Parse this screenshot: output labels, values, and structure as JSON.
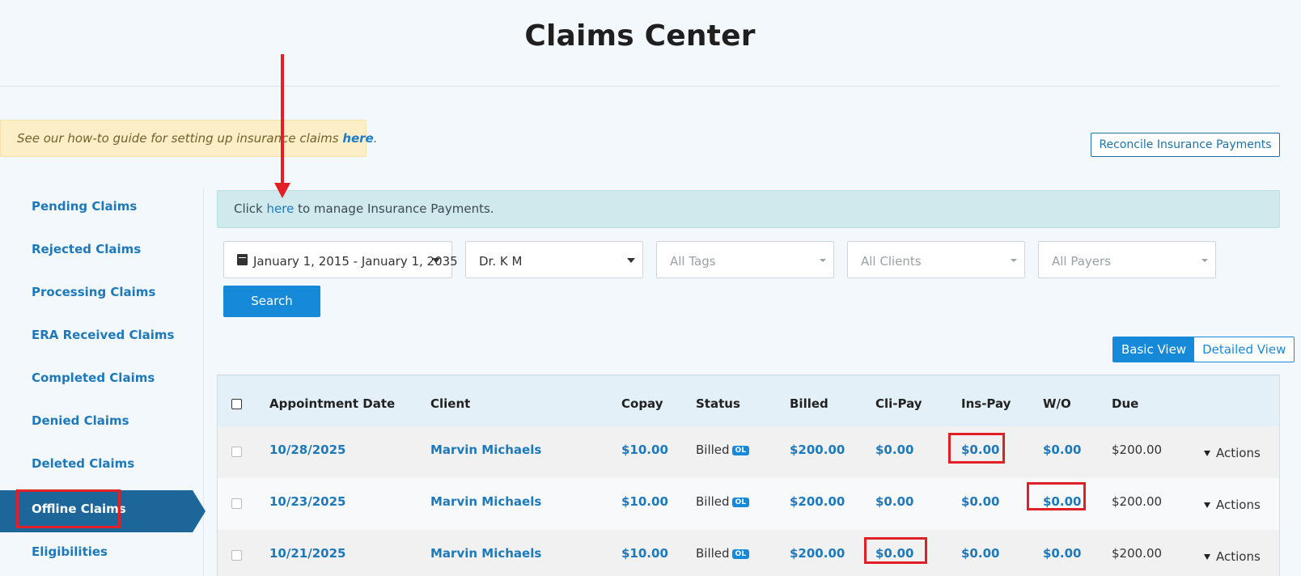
{
  "page": {
    "title": "Claims Center"
  },
  "guide_banner": {
    "prefix": "See our how-to guide for setting up insurance claims ",
    "link": "here",
    "suffix": "."
  },
  "reconcile_button": "Reconcile Insurance Payments",
  "sidebar": {
    "items": [
      {
        "label": "Pending Claims",
        "active": false
      },
      {
        "label": "Rejected Claims",
        "active": false
      },
      {
        "label": "Processing Claims",
        "active": false
      },
      {
        "label": "ERA Received Claims",
        "active": false
      },
      {
        "label": "Completed Claims",
        "active": false
      },
      {
        "label": "Denied Claims",
        "active": false
      },
      {
        "label": "Deleted Claims",
        "active": false
      },
      {
        "label": "Offline Claims",
        "active": true
      },
      {
        "label": "Eligibilities",
        "active": false
      }
    ]
  },
  "info_bar": {
    "prefix": "Click ",
    "link": "here",
    "suffix": " to manage Insurance Payments."
  },
  "filters": {
    "date_range": "January 1, 2015 - January 1, 2035",
    "provider": "Dr. K M",
    "tags_placeholder": "All Tags",
    "clients_placeholder": "All Clients",
    "payers_placeholder": "All Payers"
  },
  "search_button": "Search",
  "view_toggle": {
    "basic": "Basic View",
    "detailed": "Detailed View",
    "selected": "Basic View"
  },
  "table": {
    "headers": [
      "Appointment Date",
      "Client",
      "Copay",
      "Status",
      "Billed",
      "Cli-Pay",
      "Ins-Pay",
      "W/O",
      "Due"
    ],
    "rows": [
      {
        "date": "10/28/2025",
        "client": "Marvin Michaels",
        "copay": "$10.00",
        "status": "Billed",
        "badge": "OL",
        "billed": "$200.00",
        "cli_pay": "$0.00",
        "ins_pay": "$0.00",
        "wo": "$0.00",
        "due": "$200.00",
        "actions": "Actions"
      },
      {
        "date": "10/23/2025",
        "client": "Marvin Michaels",
        "copay": "$10.00",
        "status": "Billed",
        "badge": "OL",
        "billed": "$200.00",
        "cli_pay": "$0.00",
        "ins_pay": "$0.00",
        "wo": "$0.00",
        "due": "$200.00",
        "actions": "Actions"
      },
      {
        "date": "10/21/2025",
        "client": "Marvin Michaels",
        "copay": "$10.00",
        "status": "Billed",
        "badge": "OL",
        "billed": "$200.00",
        "cli_pay": "$0.00",
        "ins_pay": "$0.00",
        "wo": "$0.00",
        "due": "$200.00",
        "actions": "Actions"
      }
    ]
  },
  "colors": {
    "accent": "#1789d9",
    "link": "#1d79b9",
    "sidebar_active": "#1d6699",
    "annotation_red": "#e02026"
  },
  "icons": {
    "date": "calendar-icon",
    "dropdown": "caret-down-icon",
    "actions": "triangle-down-icon"
  }
}
